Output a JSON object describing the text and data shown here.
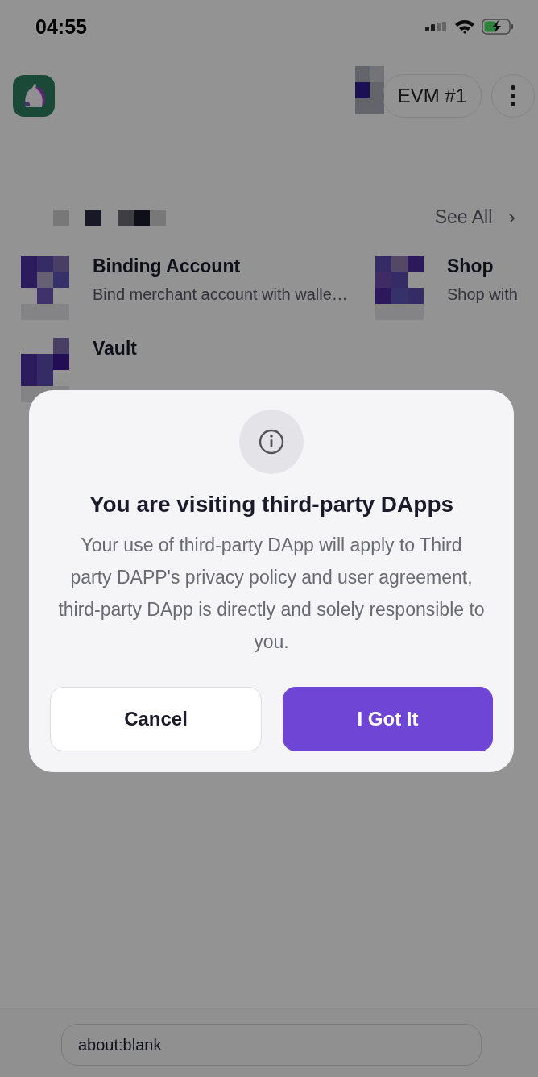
{
  "status_bar": {
    "time": "04:55"
  },
  "header": {
    "account": "EVM #1"
  },
  "section": {
    "see_all": "See All",
    "see_all_chevron": "›"
  },
  "apps": [
    {
      "title": "Binding Account",
      "subtitle": "Bind merchant account with walle…"
    },
    {
      "title": "Shop",
      "subtitle": "Shop with"
    },
    {
      "title": "Vault"
    }
  ],
  "dialog": {
    "title": "You are visiting third-party DApps",
    "body": "Your use of third-party DApp will apply to Third party DAPP's privacy policy and user agreement,  third-party DApp is directly and solely responsible to you.",
    "buttons": [
      {
        "label": "Cancel",
        "kind": "secondary"
      },
      {
        "label": "I Got It",
        "kind": "primary"
      }
    ]
  },
  "address_bar": {
    "url": "about:blank"
  }
}
